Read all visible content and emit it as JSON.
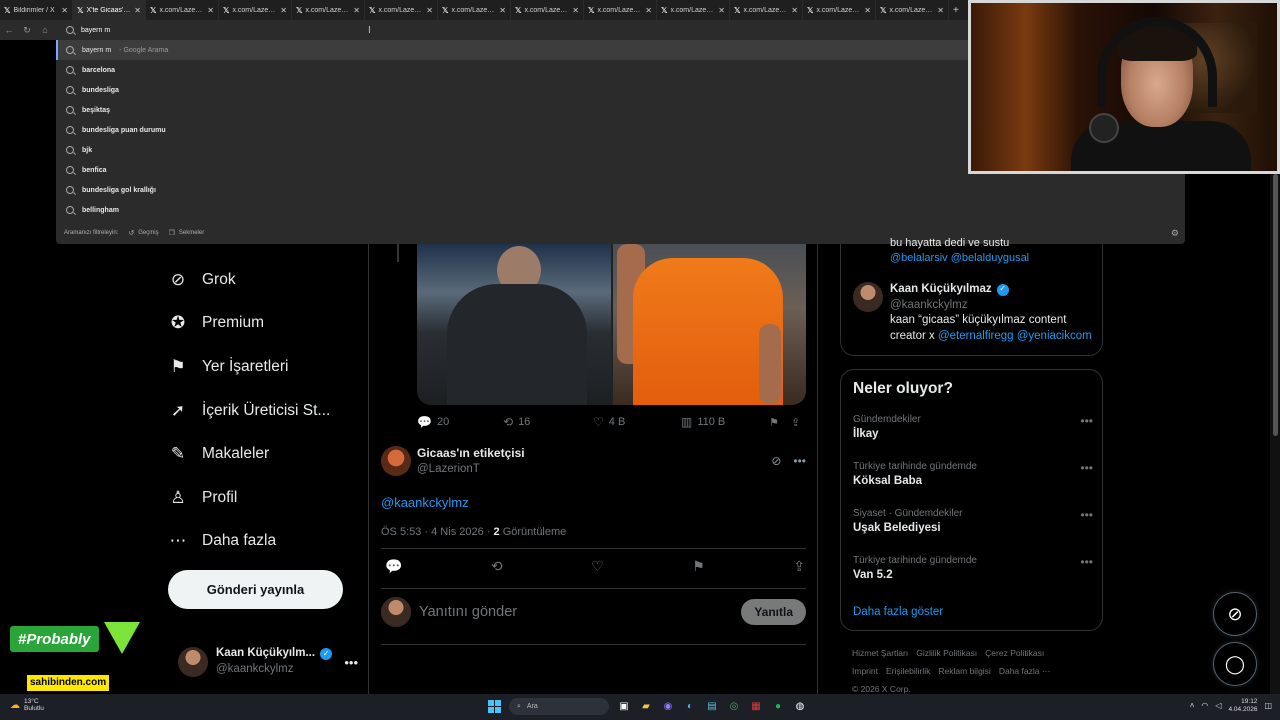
{
  "browser": {
    "tabs": [
      {
        "title": "Bildirimler / X",
        "active": false
      },
      {
        "title": "X'te Gicaas'ın eti",
        "active": true
      },
      {
        "title": "x.com/LazerionT",
        "active": false
      },
      {
        "title": "x.com/LazerionT",
        "active": false
      },
      {
        "title": "x.com/LazerionT",
        "active": false
      },
      {
        "title": "x.com/LazerionT",
        "active": false
      },
      {
        "title": "x.com/LazerionT",
        "active": false
      },
      {
        "title": "x.com/LazerionT",
        "active": false
      },
      {
        "title": "x.com/LazerionT",
        "active": false
      },
      {
        "title": "x.com/LazerionT",
        "active": false
      },
      {
        "title": "x.com/LazerionT",
        "active": false
      },
      {
        "title": "x.com/LazerionT",
        "active": false
      },
      {
        "title": "x.com/LazerionT",
        "active": false
      }
    ],
    "omnibox_value": "bayern m",
    "suggestions": {
      "first": {
        "text": "bayern m",
        "hint": "- Google Arama"
      },
      "items": [
        "barcelona",
        "bundesliga",
        "beşiktaş",
        "bundesliga puan durumu",
        "bjk",
        "benfica",
        "bundesliga gol krallığı",
        "bellingham"
      ]
    },
    "filter": {
      "label": "Aramanızı filtreleyin:",
      "history": "Geçmiş",
      "tabs": "Sekmeler"
    }
  },
  "nav": {
    "items": [
      {
        "label": "Grok",
        "icon": "grok-icon",
        "glyph": "⊘"
      },
      {
        "label": "Premium",
        "icon": "premium-icon",
        "glyph": "✪"
      },
      {
        "label": "Yer İşaretleri",
        "icon": "bookmark-icon",
        "glyph": "⚑"
      },
      {
        "label": "İçerik Üreticisi St...",
        "icon": "rocket-icon",
        "glyph": "➚"
      },
      {
        "label": "Makaleler",
        "icon": "articles-icon",
        "glyph": "✎"
      },
      {
        "label": "Profil",
        "icon": "profile-icon",
        "glyph": "♙"
      },
      {
        "label": "Daha fazla",
        "icon": "more-icon",
        "glyph": "⋯"
      }
    ],
    "post_button": "Gönderi yayınla",
    "account": {
      "name": "Kaan Küçükyılm...",
      "handle": "@kaankckylmz"
    }
  },
  "tweet_prev": {
    "stats": {
      "replies": "20",
      "retweets": "16",
      "likes": "4 B",
      "views": "110 B"
    }
  },
  "tweet": {
    "name": "Gicaas'ın etiketçisi",
    "handle": "@LazerionT",
    "body": "@kaankckylmz",
    "time": "ÖS 5:53 · 4 Nis 2026 · ",
    "views_count": "2",
    "views_label": "Görüntüleme"
  },
  "reply": {
    "placeholder": "Yanıtını gönder",
    "button": "Yanıtla"
  },
  "follow_card": {
    "prev_line": "bu hayatta dedi ve sustu",
    "prev_mentions": "@belalarsiv @belalduygusal",
    "name": "Kaan Küçükyılmaz",
    "handle": "@kaankckylmz",
    "bio": "kaan “gicaas” küçükyılmaz content creator x ",
    "bio_mentions": "@eternalfiregg @yeniacikcom"
  },
  "trends": {
    "title": "Neler oluyor?",
    "items": [
      {
        "context": "Gündemdekiler",
        "title": "İlkay"
      },
      {
        "context": "Türkiye tarihinde gündemde",
        "title": "Köksal Baba"
      },
      {
        "context": "Siyaset · Gündemdekiler",
        "title": "Uşak Belediyesi"
      },
      {
        "context": "Türkiye tarihinde gündemde",
        "title": "Van 5.2"
      }
    ],
    "show_more": "Daha fazla göster"
  },
  "footer": {
    "links": [
      "Hizmet Şartları",
      "Gizlilik Politikası",
      "Çerez Politikası",
      "Imprint",
      "Erişilebilirlik",
      "Reklam bilgisi",
      "Daha fazla ···"
    ],
    "copyright": "© 2026 X Corp."
  },
  "overlays": {
    "probably": "#Probably",
    "sahibinden": "sahibinden.com"
  },
  "taskbar": {
    "weather_temp": "13°C",
    "weather_desc": "Bulutlu",
    "search": "Ara",
    "time": "19:12",
    "date": "4.04.2026"
  }
}
